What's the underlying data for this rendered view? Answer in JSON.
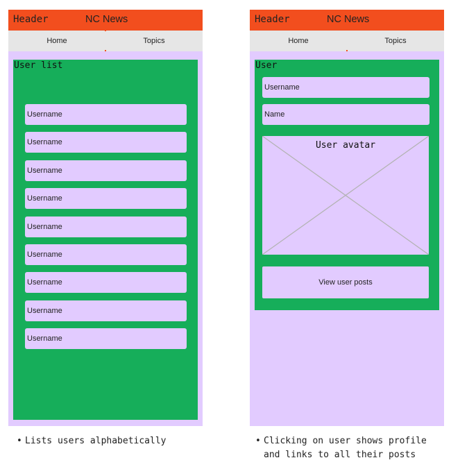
{
  "left_screen": {
    "header_label": "Header",
    "header_title": "NC News",
    "nav": [
      "Home",
      "Topics"
    ],
    "panel_title": "User list",
    "items": [
      "Username",
      "Username",
      "Username",
      "Username",
      "Username",
      "Username",
      "Username",
      "Username",
      "Username"
    ],
    "note": "Lists users alphabetically"
  },
  "right_screen": {
    "header_label": "Header",
    "header_title": "NC News",
    "nav": [
      "Home",
      "Topics"
    ],
    "panel_title": "User",
    "username_field": "Username",
    "name_field": "Name",
    "avatar_label": "User avatar",
    "posts_button": "View user posts",
    "note_line1": "Clicking on user shows profile",
    "note_line2": "and links to all their posts"
  },
  "colors": {
    "header": "#f24e1e",
    "nav": "#e6e6e6",
    "frame": "#e2cbff",
    "panel": "#16ae5a",
    "avatar_cross": "#b3b3b3"
  }
}
